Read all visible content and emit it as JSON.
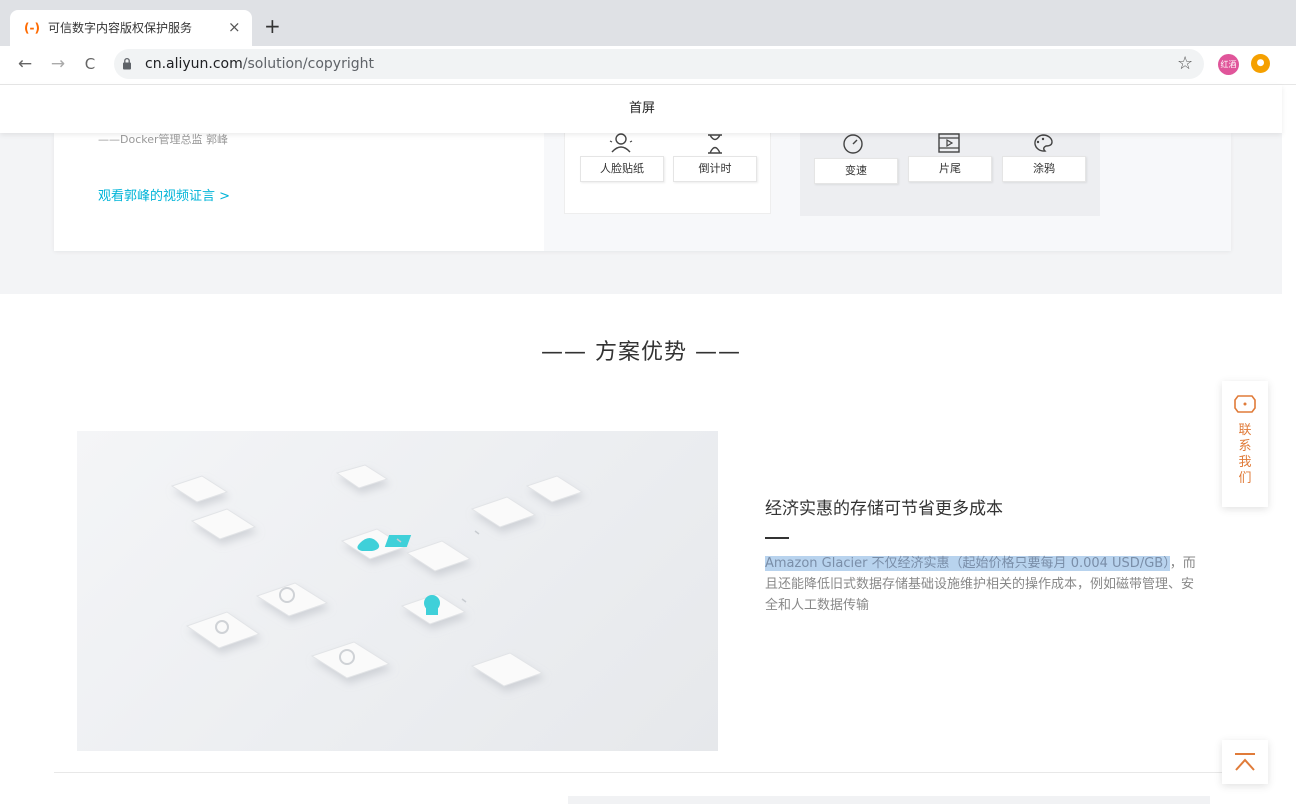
{
  "browser": {
    "tab_title": "可信数字内容版权保护服务",
    "tab_favicon": "(-)",
    "close_glyph": "×",
    "new_tab_glyph": "+",
    "back_glyph": "←",
    "forward_glyph": "→",
    "reload_glyph": "C",
    "url_domain": "cn.aliyun.com",
    "url_path": "/solution/copyright",
    "star_glyph": "☆",
    "avatar_label": "红酒",
    "extension_glyph": "●",
    "icons": [
      "aliyun-favicon",
      "back-arrow-icon",
      "forward-arrow-icon",
      "reload-icon",
      "lock-icon",
      "star-icon"
    ]
  },
  "nav": {
    "home": "首屏"
  },
  "testimonial": {
    "author": "——Docker管理总监 郭峰",
    "video_link": "观看郭峰的视频证言 >"
  },
  "features": {
    "panel_a": [
      {
        "label": "人脸贴纸",
        "icon": "face-icon",
        "glyph": "☺"
      },
      {
        "label": "倒计时",
        "icon": "hourglass-icon",
        "glyph": "⌛"
      }
    ],
    "panel_b": [
      {
        "label": "变速",
        "icon": "speedometer-icon",
        "glyph": "◔"
      },
      {
        "label": "片尾",
        "icon": "film-icon",
        "glyph": "▣"
      },
      {
        "label": "涂鸦",
        "icon": "palette-icon",
        "glyph": "❀"
      }
    ]
  },
  "advantages": {
    "section_title": "—— 方案优势 ——",
    "heading": "经济实惠的存储可节省更多成本",
    "text_highlight": "Amazon Glacier 不仅经济实惠（起始价格只要每月 0.004 USD/GB）",
    "text_rest": "，而且还能降低旧式数据存储基础设施维护相关的操作成本，例如磁带管理、安全和人工数据传输"
  },
  "widgets": {
    "contact": "联系我们",
    "back_to_top_icon": "back-to-top-icon"
  },
  "colors": {
    "accent_orange": "#ff6a00",
    "link_cyan": "#00b4d8",
    "contact_orange": "#e07b39",
    "highlight_blue": "#b8d3ee",
    "icon_cyan": "#3fd0d9"
  }
}
